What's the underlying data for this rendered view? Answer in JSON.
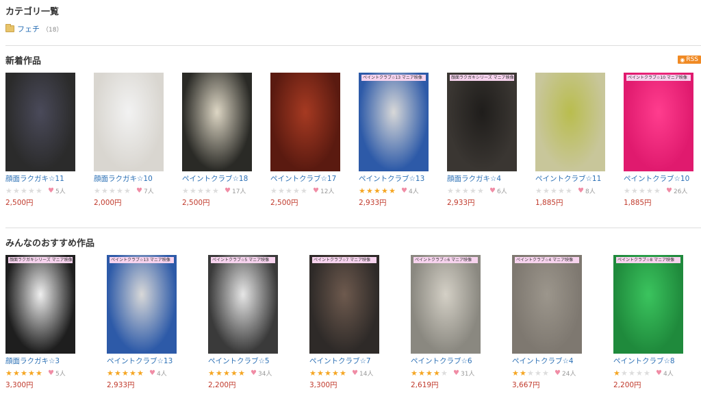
{
  "categories": {
    "title": "カテゴリ一覧",
    "items": [
      {
        "name": "フェチ",
        "count": "（18）"
      }
    ]
  },
  "new_works": {
    "title": "新着作品",
    "rss_label": "RSS",
    "items": [
      {
        "title": "顔面ラクガキ☆11",
        "rating": 0,
        "likes": "5人",
        "price": "2,500円",
        "bg": "#2b2b2b",
        "accent": "#4a4a5a",
        "banner": ""
      },
      {
        "title": "顔面ラクガキ☆10",
        "rating": 0,
        "likes": "7人",
        "price": "2,000円",
        "bg": "#d9d6d0",
        "accent": "#f2f2f2",
        "banner": ""
      },
      {
        "title": "ペイントクラブ☆18",
        "rating": 0,
        "likes": "17人",
        "price": "2,500円",
        "bg": "#2a2a26",
        "accent": "#ddd6c4",
        "banner": ""
      },
      {
        "title": "ペイントクラブ☆17",
        "rating": 0,
        "likes": "12人",
        "price": "2,500円",
        "bg": "#5a1a10",
        "accent": "#a63a22",
        "banner": ""
      },
      {
        "title": "ペイントクラブ☆13",
        "rating": 5,
        "likes": "4人",
        "price": "2,933円",
        "bg": "#2d5aa8",
        "accent": "#d8d8d8",
        "banner": "ペイントクラブ☆13 マニア映像"
      },
      {
        "title": "顔面ラクガキ☆4",
        "rating": 0,
        "likes": "6人",
        "price": "2,933円",
        "bg": "#3a3632",
        "accent": "#1f1d1b",
        "banner": "顔面ラクガキシリーズ マニア映像"
      },
      {
        "title": "ペイントクラブ☆11",
        "rating": 0,
        "likes": "8人",
        "price": "1,885円",
        "bg": "#c8c69a",
        "accent": "#b9bd4e",
        "banner": ""
      },
      {
        "title": "ペイントクラブ☆10",
        "rating": 0,
        "likes": "26人",
        "price": "1,885円",
        "bg": "#e01a6e",
        "accent": "#ff3d8e",
        "banner": "ペイントクラブ☆10 マニア映像"
      }
    ]
  },
  "recommended": {
    "title": "みんなのおすすめ作品",
    "items": [
      {
        "title": "顔面ラクガキ☆3",
        "rating": 5,
        "likes": "5人",
        "price": "3,300円",
        "bg": "#1e1e1e",
        "accent": "#efefef",
        "banner": "顔面ラクガキシリーズ マニア映像"
      },
      {
        "title": "ペイントクラブ☆13",
        "rating": 5,
        "likes": "4人",
        "price": "2,933円",
        "bg": "#2d5aa8",
        "accent": "#d8d8d8",
        "banner": "ペイントクラブ☆13 マニア映像"
      },
      {
        "title": "ペイントクラブ☆5",
        "rating": 5,
        "likes": "34人",
        "price": "2,200円",
        "bg": "#3a3a3a",
        "accent": "#e6e6e6",
        "banner": "ペイントクラブ☆5 マニア映像"
      },
      {
        "title": "ペイントクラブ☆7",
        "rating": 4.5,
        "likes": "14人",
        "price": "3,300円",
        "bg": "#2e2a28",
        "accent": "#6e5a4e",
        "banner": "ペイントクラブ☆7 マニア映像"
      },
      {
        "title": "ペイントクラブ☆6",
        "rating": 4,
        "likes": "31人",
        "price": "2,619円",
        "bg": "#8a8880",
        "accent": "#d4d0c6",
        "banner": "ペイントクラブ☆6 マニア映像"
      },
      {
        "title": "ペイントクラブ☆4",
        "rating": 2,
        "likes": "24人",
        "price": "3,667円",
        "bg": "#7e7870",
        "accent": "#9c968c",
        "banner": "ペイントクラブ☆4 マニア映像"
      },
      {
        "title": "ペイントクラブ☆8",
        "rating": 1,
        "likes": "4人",
        "price": "2,200円",
        "bg": "#1f8a3c",
        "accent": "#3bc45e",
        "banner": "ペイントクラブ☆8 マニア映像"
      }
    ]
  }
}
